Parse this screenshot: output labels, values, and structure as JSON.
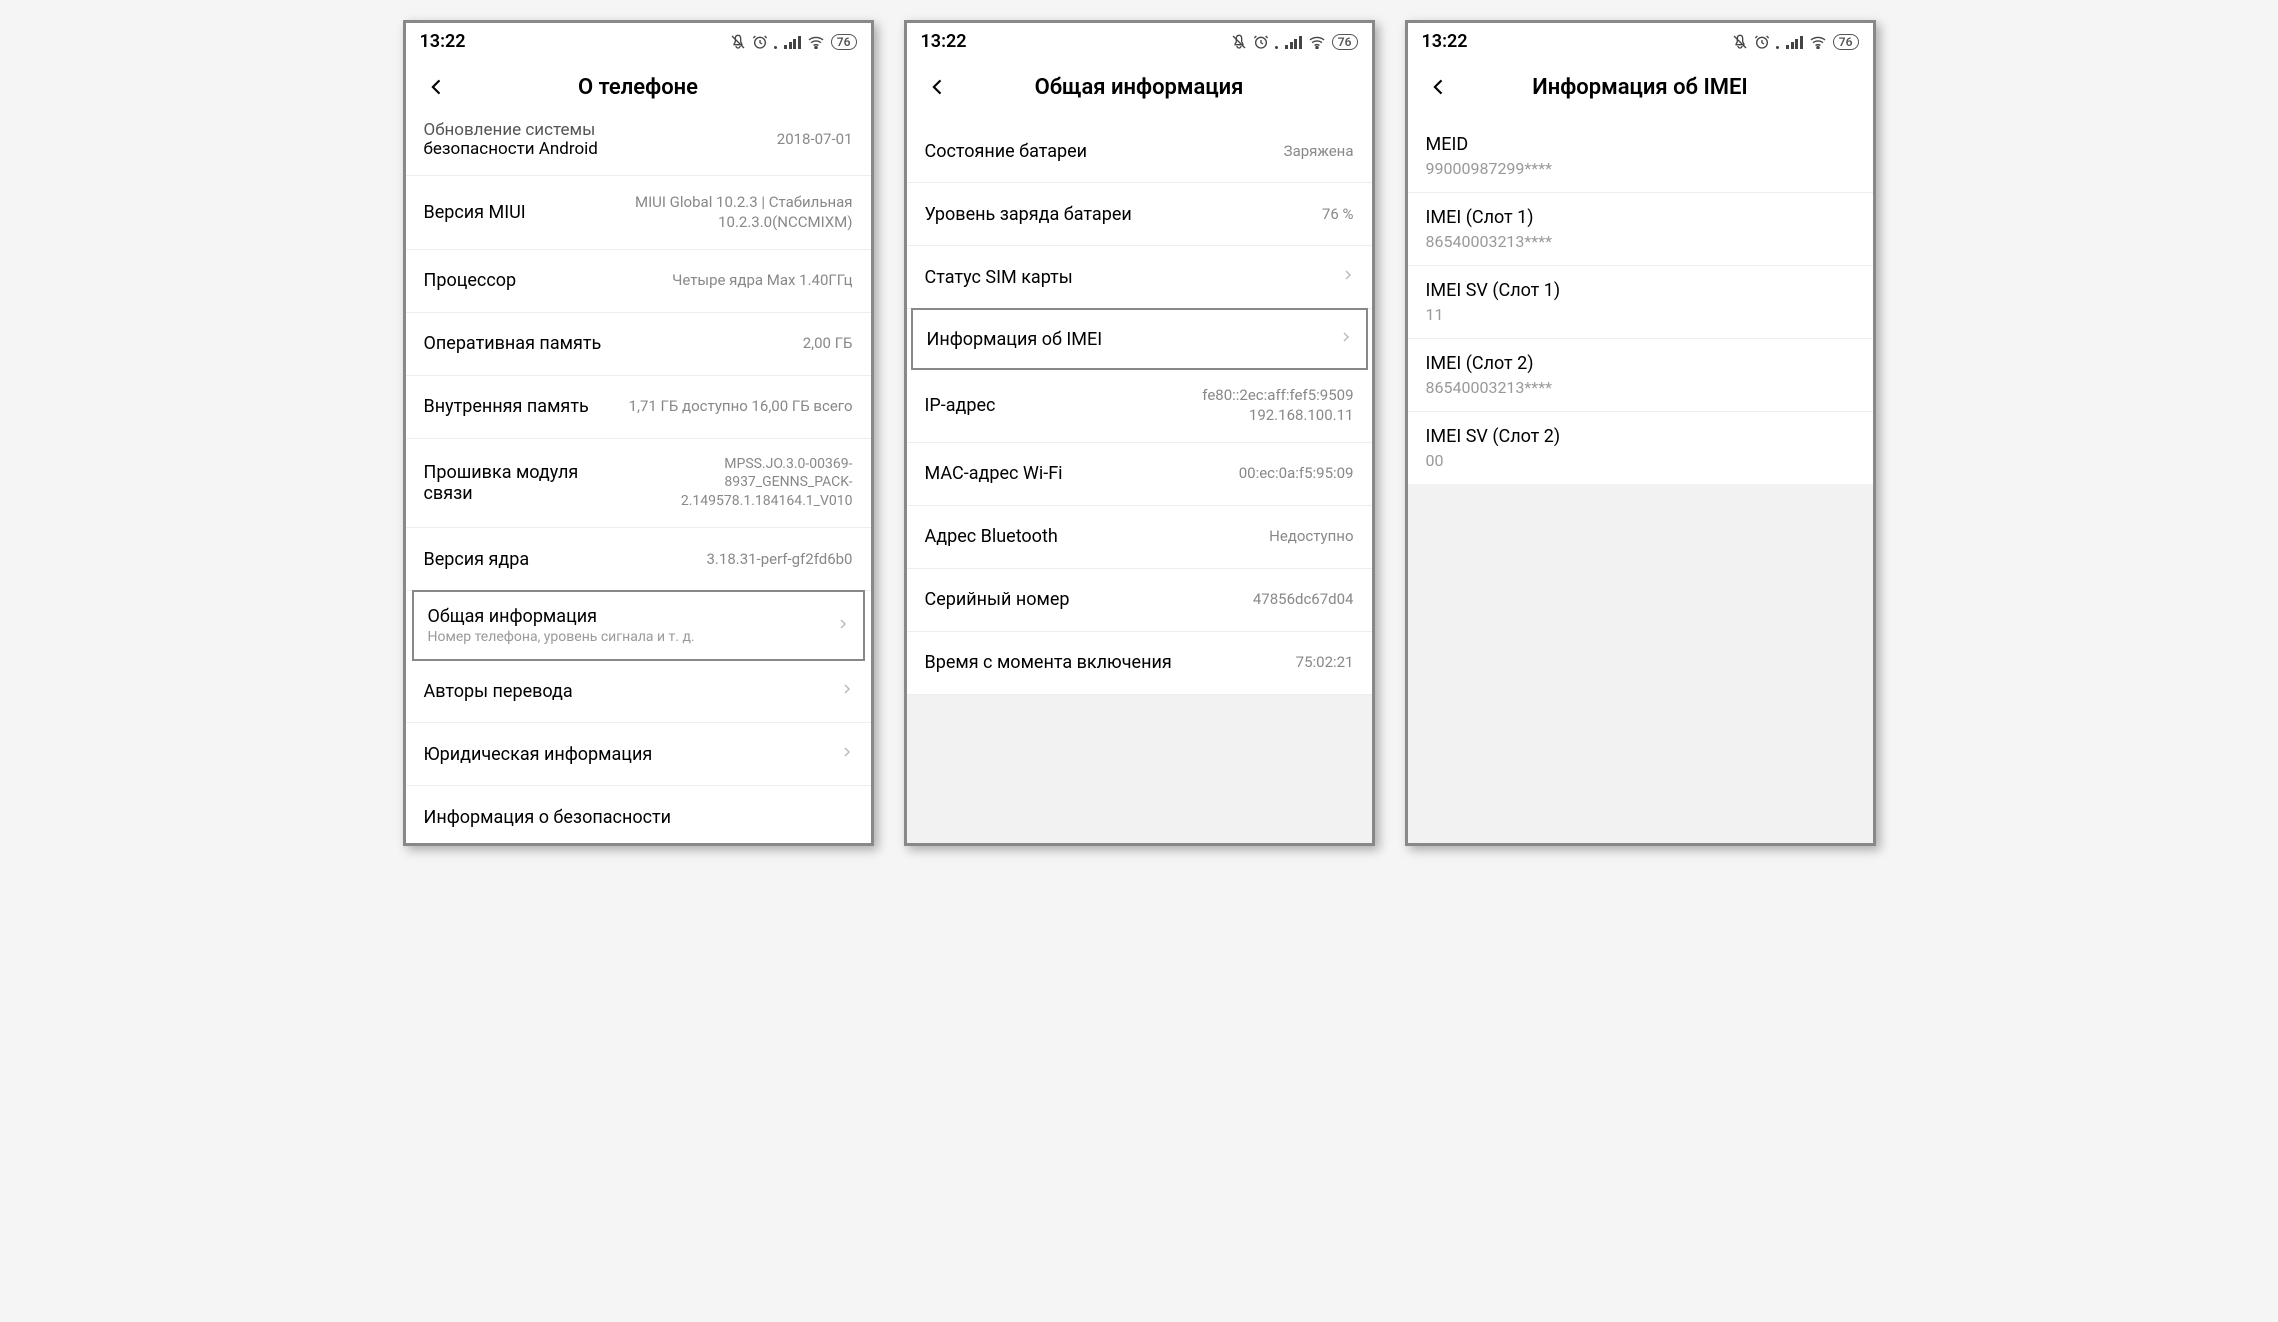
{
  "status": {
    "time": "13:22",
    "battery": "76"
  },
  "phone1": {
    "title": "О телефоне",
    "rows": [
      {
        "label_top": "Обновление системы",
        "label": "безопасности Android",
        "value": "2018-07-01"
      },
      {
        "label": "Версия MIUI",
        "value": "MIUI Global 10.2.3 | Стабильная 10.2.3.0(NCCMIXM)"
      },
      {
        "label": "Процессор",
        "value": "Четыре ядра Мах 1.40ГГц"
      },
      {
        "label": "Оперативная память",
        "value": "2,00 ГБ"
      },
      {
        "label": "Внутренняя память",
        "value": "1,71 ГБ доступно 16,00 ГБ всего"
      },
      {
        "label": "Прошивка модуля связи",
        "value": "MPSS.JO.3.0-00369-8937_GENNS_PACK-2.149578.1.184164.1_V010"
      },
      {
        "label": "Версия ядра",
        "value": "3.18.31-perf-gf2fd6b0"
      },
      {
        "label": "Общая информация",
        "sub": "Номер телефона, уровень сигнала и т. д.",
        "chev": true,
        "hl": true
      },
      {
        "label": "Авторы перевода",
        "chev": true
      },
      {
        "label": "Юридическая информация",
        "chev": true
      },
      {
        "label": "Информация о безопасности",
        "chev": true
      }
    ]
  },
  "phone2": {
    "title": "Общая информация",
    "rows": [
      {
        "label": "Состояние батареи",
        "value": "Заряжена"
      },
      {
        "label": "Уровень заряда батареи",
        "value": "76 %"
      },
      {
        "label": "Статус SIM карты",
        "chev": true
      },
      {
        "label": "Информация об IMEI",
        "chev": true,
        "hl": true
      },
      {
        "label": "IP-адрес",
        "value": "fe80::2ec:aff:fef5:9509 192.168.100.11"
      },
      {
        "label": "MAC-адрес Wi-Fi",
        "value": "00:ec:0a:f5:95:09"
      },
      {
        "label": "Адрес Bluetooth",
        "value": "Недоступно"
      },
      {
        "label": "Серийный номер",
        "value": "47856dc67d04"
      },
      {
        "label": "Время с момента включения",
        "value": "75:02:21"
      }
    ]
  },
  "phone3": {
    "title": "Информация об IMEI",
    "rows": [
      {
        "label": "MEID",
        "value": "99000987299****"
      },
      {
        "label": "IMEI (Слот 1)",
        "value": "86540003213****"
      },
      {
        "label": "IMEI SV (Слот 1)",
        "value": "11"
      },
      {
        "label": "IMEI (Слот 2)",
        "value": "86540003213****"
      },
      {
        "label": "IMEI SV (Слот 2)",
        "value": "00"
      }
    ]
  }
}
